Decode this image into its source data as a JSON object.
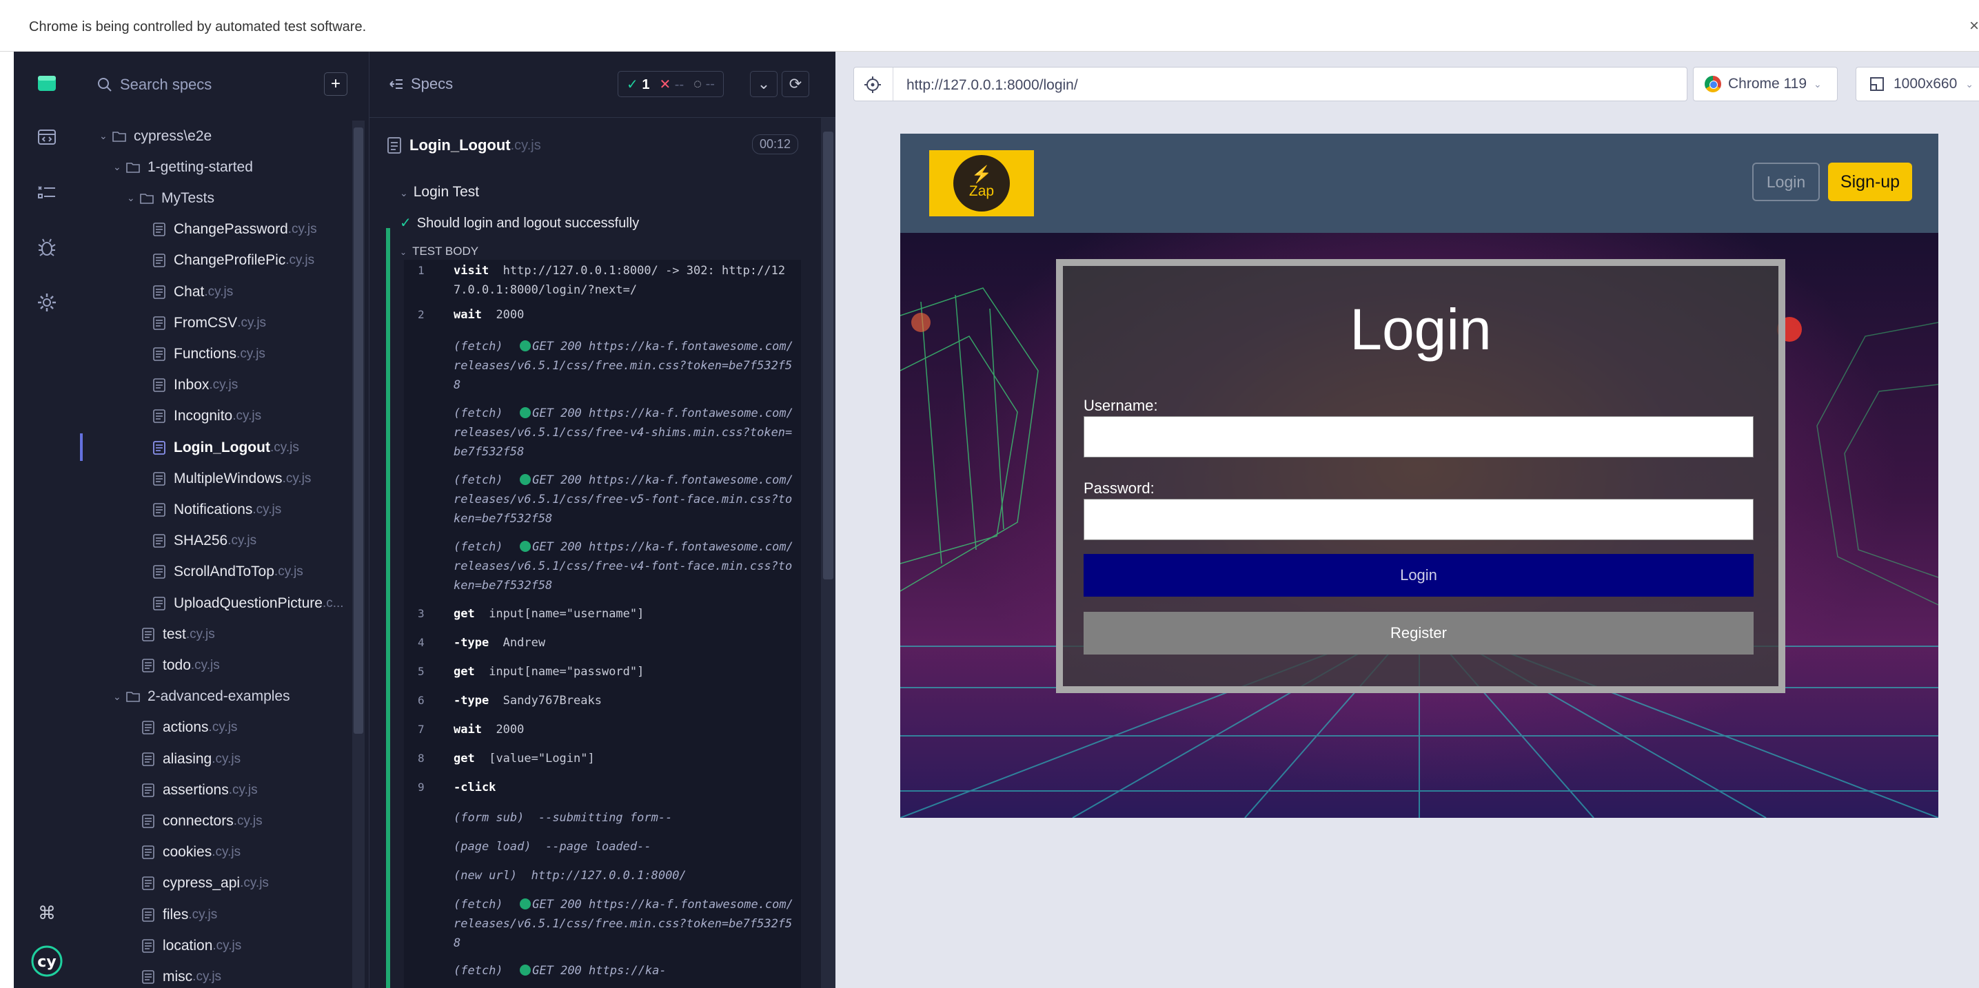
{
  "chrome": {
    "automation_message": "Chrome is being controlled by automated test software.",
    "close_glyph": "×"
  },
  "sidebar": {
    "search_placeholder": "Search specs",
    "add_glyph": "+",
    "tree": [
      {
        "kind": "folder",
        "name": "cypress\\e2e",
        "depth": 0,
        "open": true
      },
      {
        "kind": "folder",
        "name": "1-getting-started",
        "depth": 1,
        "open": true
      },
      {
        "kind": "folder",
        "name": "MyTests",
        "depth": 2,
        "open": true
      },
      {
        "kind": "file",
        "name": "ChangePassword",
        "ext": ".cy.js",
        "depth": 3
      },
      {
        "kind": "file",
        "name": "ChangeProfilePic",
        "ext": ".cy.js",
        "depth": 3
      },
      {
        "kind": "file",
        "name": "Chat",
        "ext": ".cy.js",
        "depth": 3
      },
      {
        "kind": "file",
        "name": "FromCSV",
        "ext": ".cy.js",
        "depth": 3
      },
      {
        "kind": "file",
        "name": "Functions",
        "ext": ".cy.js",
        "depth": 3
      },
      {
        "kind": "file",
        "name": "Inbox",
        "ext": ".cy.js",
        "depth": 3
      },
      {
        "kind": "file",
        "name": "Incognito",
        "ext": ".cy.js",
        "depth": 3
      },
      {
        "kind": "file",
        "name": "Login_Logout",
        "ext": ".cy.js",
        "depth": 3,
        "active": true
      },
      {
        "kind": "file",
        "name": "MultipleWindows",
        "ext": ".cy.js",
        "depth": 3
      },
      {
        "kind": "file",
        "name": "Notifications",
        "ext": ".cy.js",
        "depth": 3
      },
      {
        "kind": "file",
        "name": "SHA256",
        "ext": ".cy.js",
        "depth": 3
      },
      {
        "kind": "file",
        "name": "ScrollAndToTop",
        "ext": ".cy.js",
        "depth": 3
      },
      {
        "kind": "file",
        "name": "UploadQuestionPicture",
        "ext": ".c...",
        "depth": 3
      },
      {
        "kind": "file",
        "name": "test",
        "ext": ".cy.js",
        "depth": 2
      },
      {
        "kind": "file",
        "name": "todo",
        "ext": ".cy.js",
        "depth": 2
      },
      {
        "kind": "folder",
        "name": "2-advanced-examples",
        "depth": 1,
        "open": true
      },
      {
        "kind": "file",
        "name": "actions",
        "ext": ".cy.js",
        "depth": 2
      },
      {
        "kind": "file",
        "name": "aliasing",
        "ext": ".cy.js",
        "depth": 2
      },
      {
        "kind": "file",
        "name": "assertions",
        "ext": ".cy.js",
        "depth": 2
      },
      {
        "kind": "file",
        "name": "connectors",
        "ext": ".cy.js",
        "depth": 2
      },
      {
        "kind": "file",
        "name": "cookies",
        "ext": ".cy.js",
        "depth": 2
      },
      {
        "kind": "file",
        "name": "cypress_api",
        "ext": ".cy.js",
        "depth": 2
      },
      {
        "kind": "file",
        "name": "files",
        "ext": ".cy.js",
        "depth": 2
      },
      {
        "kind": "file",
        "name": "location",
        "ext": ".cy.js",
        "depth": 2
      },
      {
        "kind": "file",
        "name": "misc",
        "ext": ".cy.js",
        "depth": 2
      }
    ]
  },
  "reporter": {
    "specs_label": "Specs",
    "stats": {
      "passed_glyph": "✓",
      "passed": "1",
      "failed_glyph": "✕",
      "failed": "--",
      "pending_glyph": "◌",
      "pending": "--"
    },
    "spec_name": "Login_Logout",
    "spec_ext": ".cy.js",
    "duration": "00:12",
    "suite": "Login Test",
    "test": "Should login and logout successfully",
    "test_body": "TEST BODY",
    "commands": [
      {
        "num": "1",
        "name": "visit",
        "msg": "http://127.0.0.1:8000/ -> 302: http://127.0.0.1:8000/login/?next=/"
      },
      {
        "num": "2",
        "name": "wait",
        "msg": "2000"
      },
      {
        "event": "(fetch)",
        "status": "GET 200",
        "msg": "https://ka-f.fontawesome.com/releases/v6.5.1/css/free.min.css?token=be7f532f58"
      },
      {
        "event": "(fetch)",
        "status": "GET 200",
        "msg": "https://ka-f.fontawesome.com/releases/v6.5.1/css/free-v4-shims.min.css?token=be7f532f58"
      },
      {
        "event": "(fetch)",
        "status": "GET 200",
        "msg": "https://ka-f.fontawesome.com/releases/v6.5.1/css/free-v5-font-face.min.css?token=be7f532f58"
      },
      {
        "event": "(fetch)",
        "status": "GET 200",
        "msg": "https://ka-f.fontawesome.com/releases/v6.5.1/css/free-v4-font-face.min.css?token=be7f532f58"
      },
      {
        "num": "3",
        "name": "get",
        "msg": "input[name=\"username\"]"
      },
      {
        "num": "4",
        "name": "-type",
        "msg": "Andrew"
      },
      {
        "num": "5",
        "name": "get",
        "msg": "input[name=\"password\"]"
      },
      {
        "num": "6",
        "name": "-type",
        "msg": "Sandy767Breaks"
      },
      {
        "num": "7",
        "name": "wait",
        "msg": "2000"
      },
      {
        "num": "8",
        "name": "get",
        "msg": "[value=\"Login\"]"
      },
      {
        "num": "9",
        "name": "-click",
        "msg": ""
      },
      {
        "event": "(form sub)",
        "msg": "--submitting form--"
      },
      {
        "event": "(page load)",
        "msg": "--page loaded--"
      },
      {
        "event": "(new url)",
        "msg": "http://127.0.0.1:8000/"
      },
      {
        "event": "(fetch)",
        "status": "GET 200",
        "msg": "https://ka-f.fontawesome.com/releases/v6.5.1/css/free.min.css?token=be7f532f58"
      },
      {
        "event": "(fetch)",
        "status": "GET 200",
        "msg": "https://ka-"
      }
    ]
  },
  "aut": {
    "url": "http://127.0.0.1:8000/login/",
    "browser": "Chrome 119",
    "viewport": "1000x660"
  },
  "app": {
    "logo_text": "Zap",
    "nav_login": "Login",
    "nav_signup": "Sign-up",
    "form_title": "Login",
    "username_label": "Username:",
    "password_label": "Password:",
    "login_button": "Login",
    "register_button": "Register"
  },
  "colors": {
    "runner_bg": "#1b1e2e",
    "pass": "#1fd09e",
    "fail": "#ff5870",
    "brand_yellow": "#f7c500",
    "login_blue": "#000080"
  }
}
